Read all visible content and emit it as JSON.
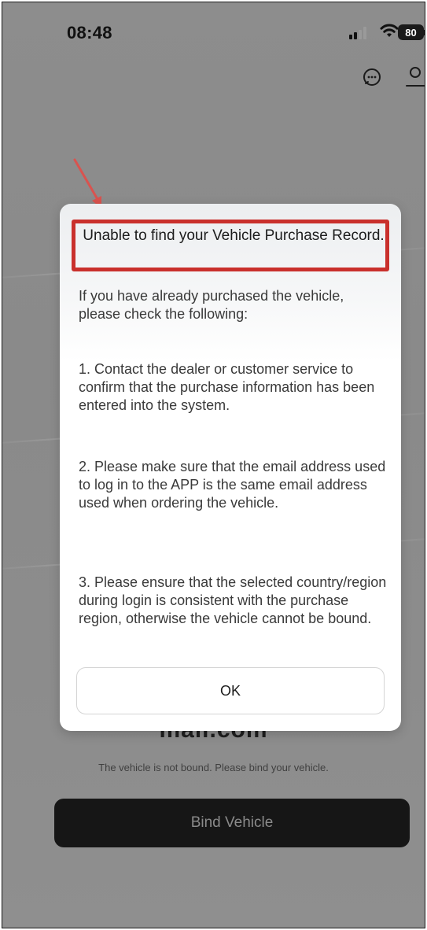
{
  "status_bar": {
    "time": "08:48",
    "battery": "80"
  },
  "header": {
    "icons": [
      "message-icon",
      "user-icon"
    ]
  },
  "background": {
    "brand_text": "mall.com",
    "status_text": "The vehicle is not bound. Please bind your vehicle.",
    "bind_button_label": "Bind Vehicle"
  },
  "dialog": {
    "title": "Unable to find your Vehicle Purchase Record.",
    "intro": "If you have already purchased the vehicle, please check the following:",
    "items": [
      "1. Contact the dealer or customer service to confirm that the purchase information has been entered into the system.",
      "2. Please make sure that the email address used to log in to the APP is the same email address used when ordering the vehicle.",
      "3. Please ensure that the selected country/region during login is consistent with the purchase region, otherwise the vehicle cannot be bound."
    ],
    "ok_label": "OK"
  },
  "colors": {
    "highlight": "#c9302c",
    "dark_button": "#161616",
    "overlay": "#8c8c8c"
  }
}
